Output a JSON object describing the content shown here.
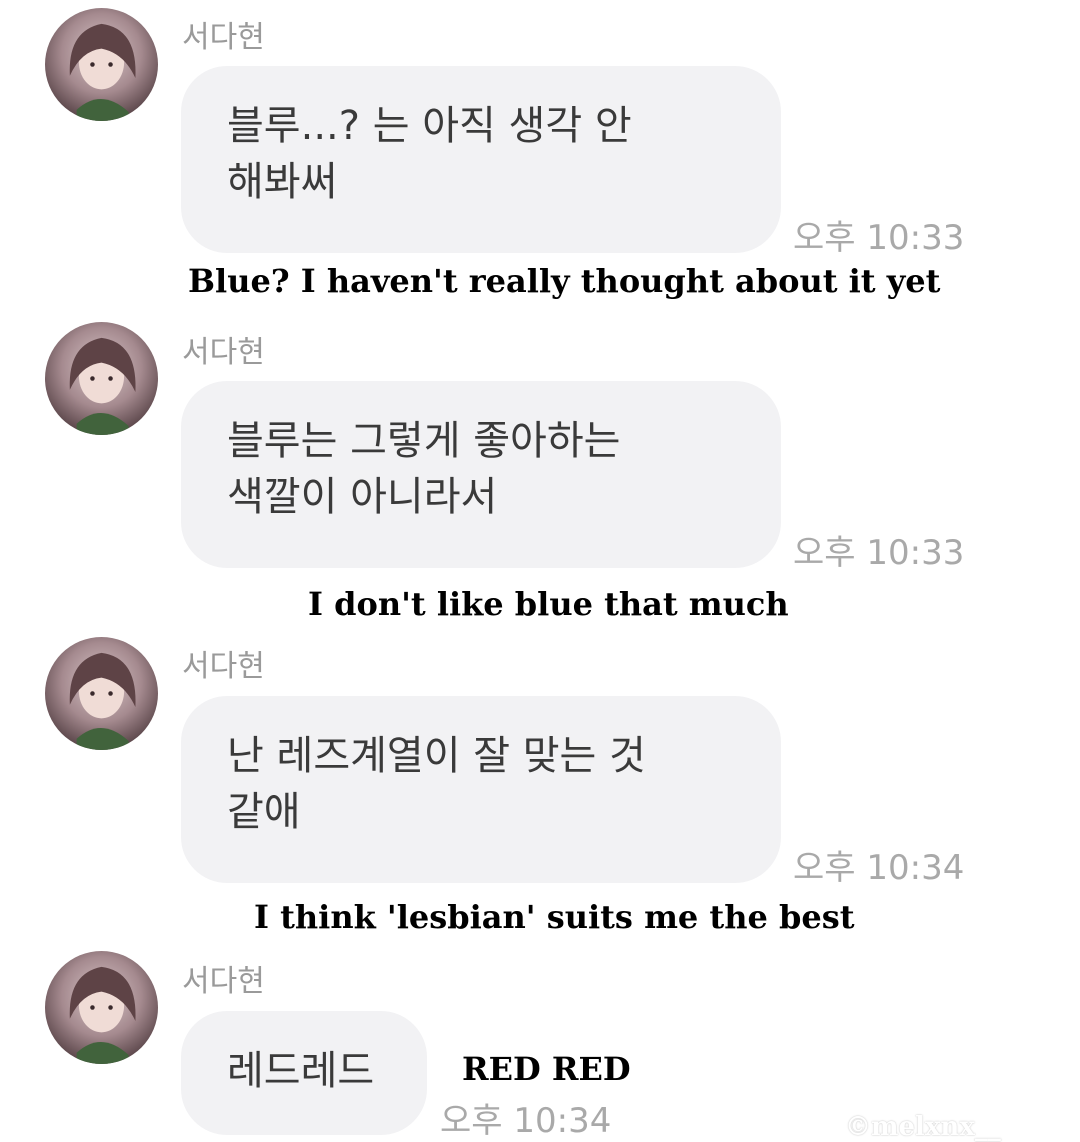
{
  "messages": [
    {
      "sender": "서다현",
      "lines": [
        "블루...? 는 아직 생각 안",
        "해봐써"
      ],
      "time": "오후 10:33",
      "caption": "Blue? I haven't really thought about it yet"
    },
    {
      "sender": "서다현",
      "lines": [
        "블루는 그렇게 좋아하는",
        "색깔이 아니라서"
      ],
      "time": "오후 10:33",
      "caption": "I don't like blue that much"
    },
    {
      "sender": "서다현",
      "lines": [
        "난 레즈계열이 잘 맞는 것",
        "같애"
      ],
      "time": "오후 10:34",
      "caption": "I think 'lesbian' suits me the best"
    },
    {
      "sender": "서다현",
      "lines": [
        "레드레드"
      ],
      "time": "오후 10:34",
      "caption": "RED RED"
    }
  ],
  "watermark": "©melxnx__",
  "colors": {
    "bubble_bg": "#f2f2f4",
    "sender_text": "#9a9a9a",
    "message_text": "#3a3a3a",
    "time_text": "#a9a9a9",
    "caption_text": "#000000"
  },
  "icons": {
    "avatar": "profile-photo-avatar"
  }
}
